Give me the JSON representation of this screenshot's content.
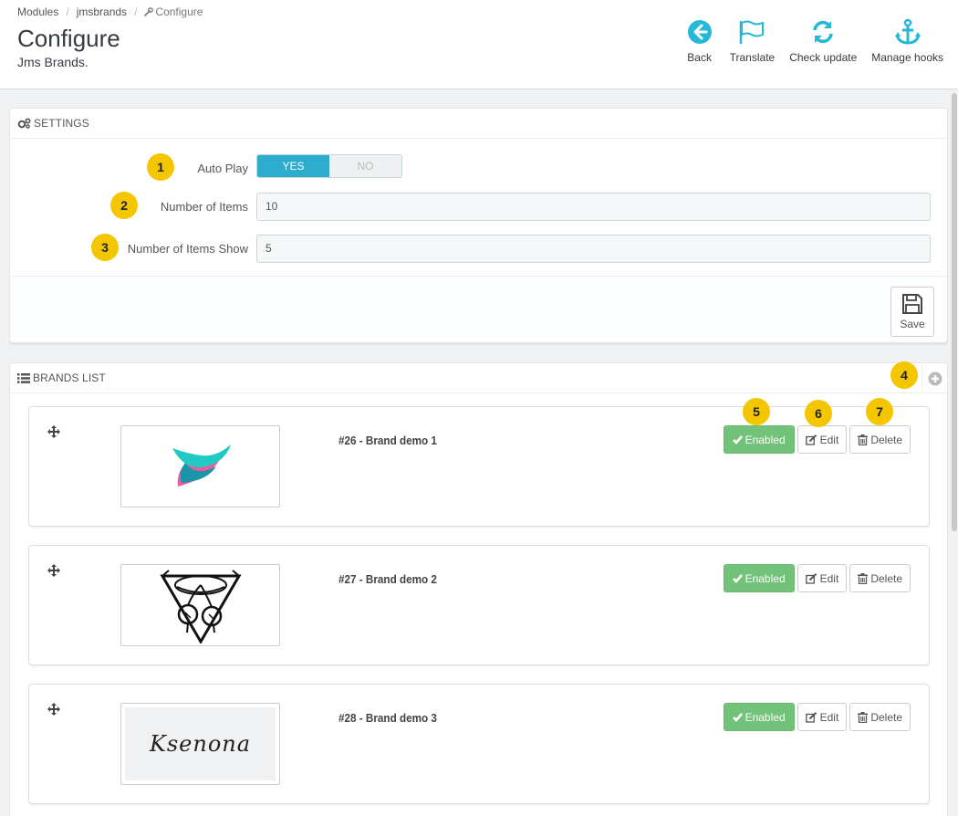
{
  "breadcrumb": {
    "modules": "Modules",
    "module": "jmsbrands",
    "current": "Configure"
  },
  "header": {
    "title": "Configure",
    "subtitle": "Jms Brands."
  },
  "toolbar": {
    "back": "Back",
    "translate": "Translate",
    "check_update": "Check update",
    "manage_hooks": "Manage hooks"
  },
  "settings": {
    "heading": "Settings",
    "auto_play": {
      "label": "Auto Play",
      "yes": "YES",
      "no": "NO",
      "value": "YES"
    },
    "number_items": {
      "label": "Number of Items",
      "value": "10"
    },
    "number_items_show": {
      "label": "Number of Items Show",
      "value": "5"
    },
    "save_label": "Save"
  },
  "brands_list": {
    "heading": "Brands list",
    "items": [
      {
        "title": "#26 - Brand demo 1",
        "status": "Enabled",
        "edit": "Edit",
        "delete": "Delete"
      },
      {
        "title": "#27 - Brand demo 2",
        "status": "Enabled",
        "edit": "Edit",
        "delete": "Delete"
      },
      {
        "title": "#28 - Brand demo 3",
        "status": "Enabled",
        "edit": "Edit",
        "delete": "Delete"
      }
    ]
  },
  "badges": [
    "1",
    "2",
    "3",
    "4",
    "5",
    "6",
    "7"
  ],
  "logo3_text": "Ksenona",
  "colors": {
    "accent": "#25b9d7",
    "switch_on": "#2eacce",
    "enabled": "#72c279",
    "badge": "#f3c600"
  }
}
